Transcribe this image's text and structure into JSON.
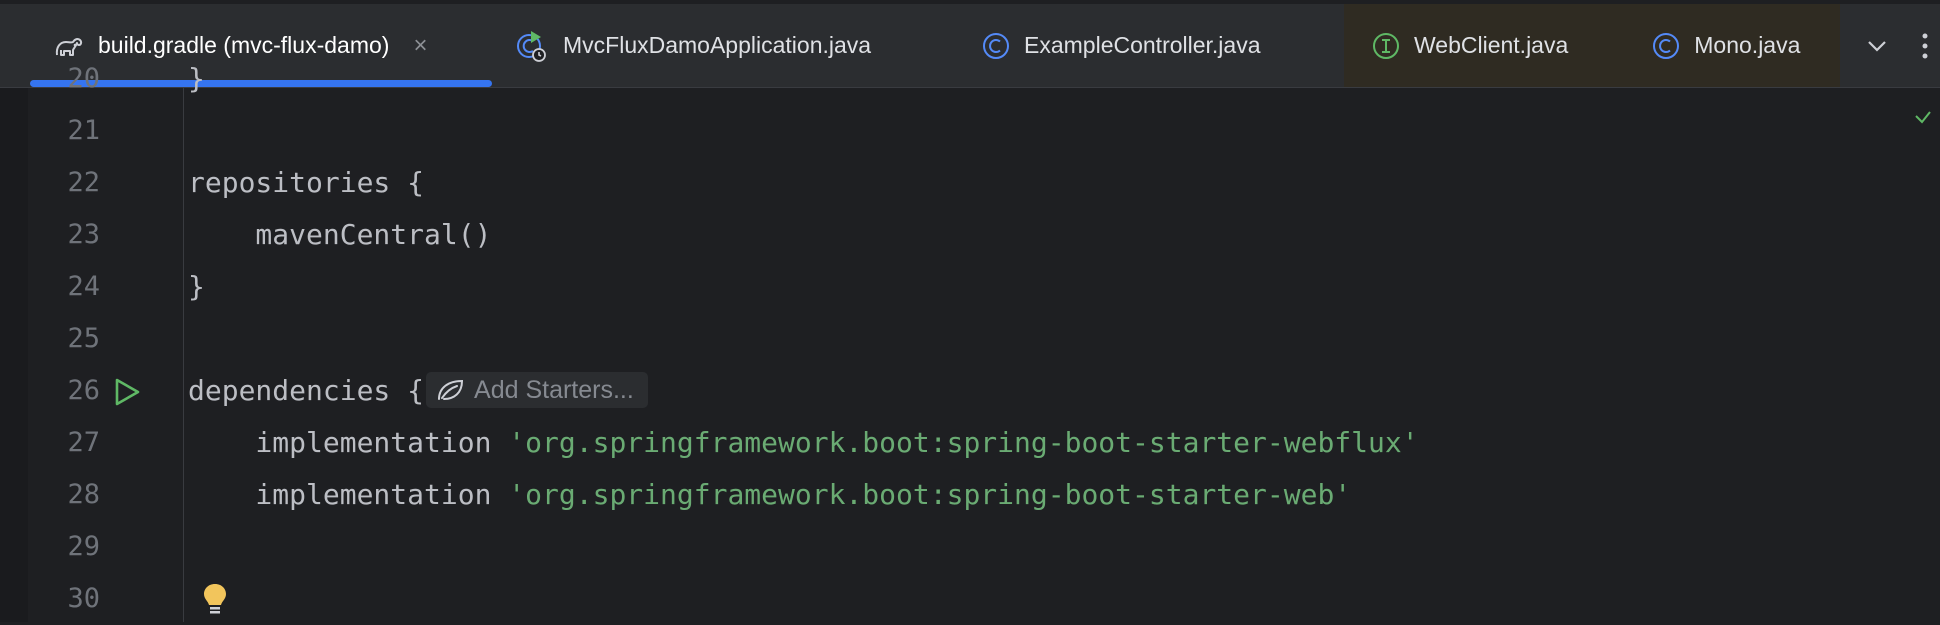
{
  "tabs": [
    {
      "label": "build.gradle (mvc-flux-damo)",
      "icon": "gradle-elephant-icon",
      "active": true,
      "closable": true
    },
    {
      "label": "MvcFluxDamoApplication.java",
      "icon": "spring-boot-run-class-icon"
    },
    {
      "label": "ExampleController.java",
      "icon": "class-icon"
    },
    {
      "label": "WebClient.java",
      "icon": "interface-icon"
    },
    {
      "label": "Mono.java",
      "icon": "class-icon"
    }
  ],
  "tab_close_symbol": "×",
  "editor": {
    "lines": [
      {
        "num": "20",
        "text": "}"
      },
      {
        "num": "21",
        "text": ""
      },
      {
        "num": "22",
        "text": "repositories {"
      },
      {
        "num": "23",
        "text": "    mavenCentral()"
      },
      {
        "num": "24",
        "text": "}"
      },
      {
        "num": "25",
        "text": ""
      },
      {
        "num": "26",
        "text": "dependencies {"
      },
      {
        "num": "27",
        "code": "    implementation ",
        "str": "'org.springframework.boot:spring-boot-starter-webflux'"
      },
      {
        "num": "28",
        "code": "    implementation ",
        "str": "'org.springframework.boot:spring-boot-starter-web'"
      },
      {
        "num": "29",
        "text": ""
      },
      {
        "num": "30",
        "text": ""
      }
    ],
    "hint_label": "Add Starters..."
  },
  "colors": {
    "accent": "#3574f0",
    "string": "#6aab73",
    "run_green": "#5fb865",
    "bulb": "#f2c55c"
  }
}
